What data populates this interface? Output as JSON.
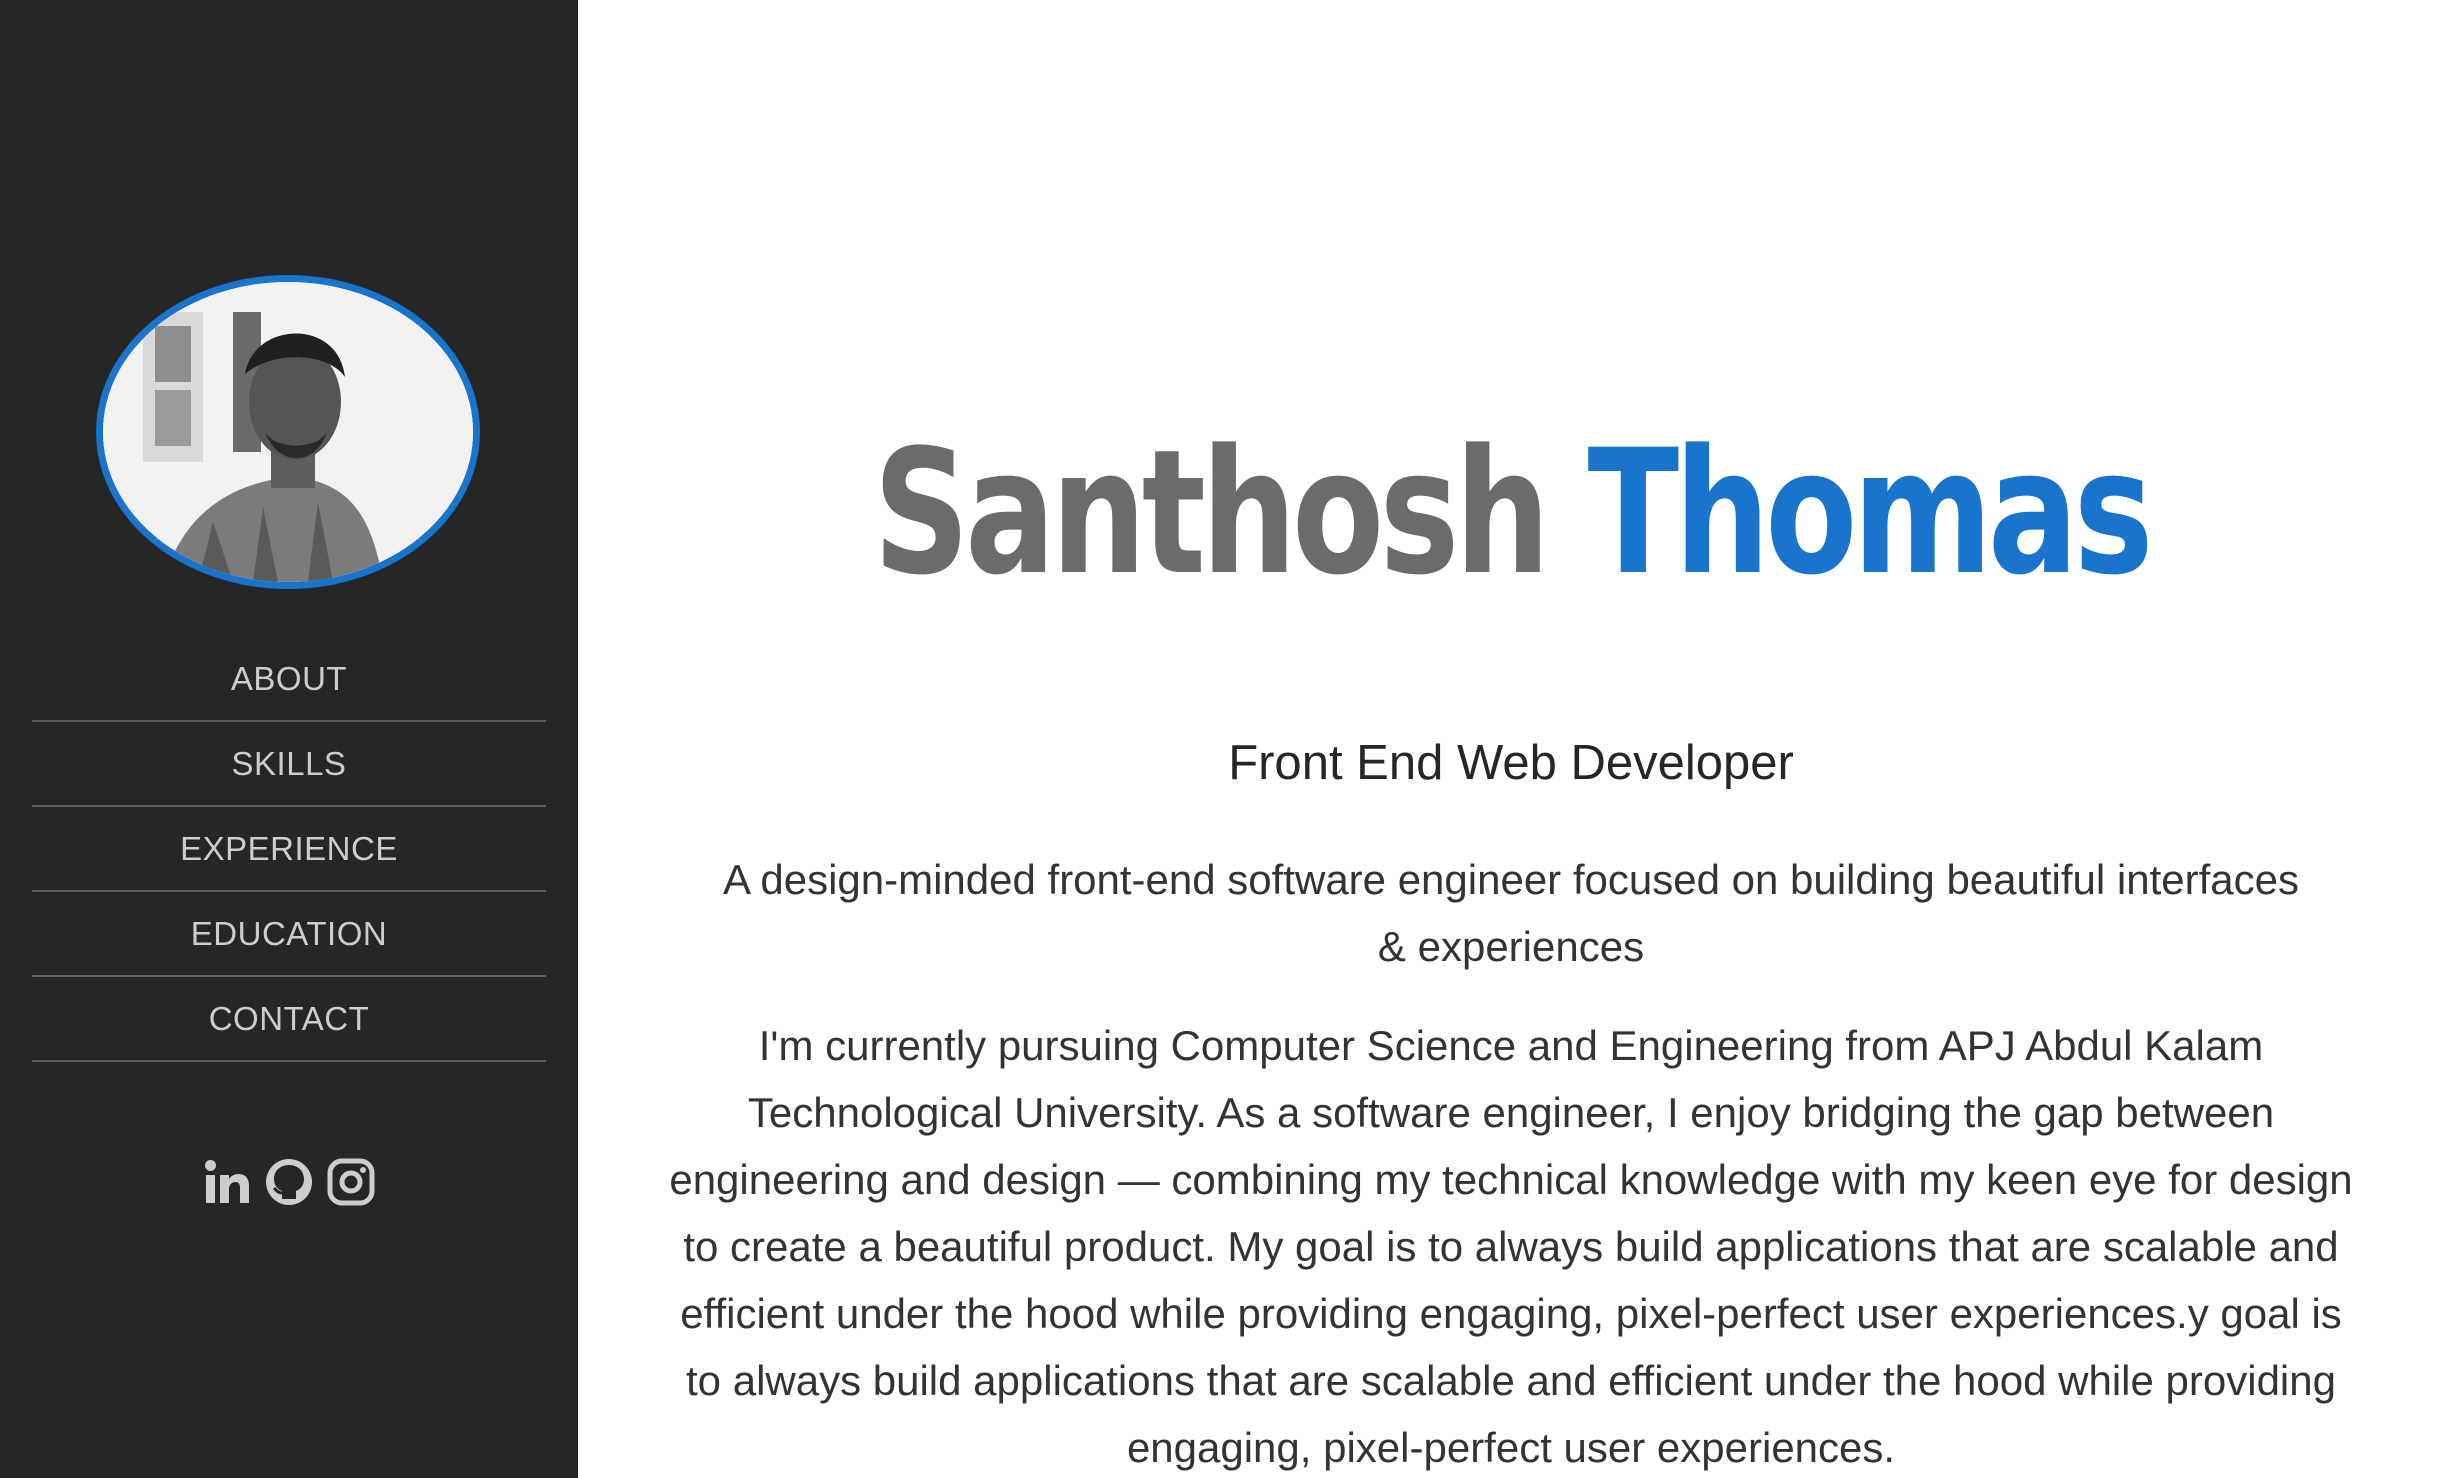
{
  "sidebar": {
    "nav": [
      "ABOUT",
      "SKILLS",
      "EXPERIENCE",
      "EDUCATION",
      "CONTACT"
    ],
    "socials": [
      "linkedin-icon",
      "github-icon",
      "instagram-icon"
    ]
  },
  "main": {
    "first_name": "Santhosh",
    "last_name": "Thomas",
    "role": "Front End Web Developer",
    "tagline": "A design-minded front-end software engineer focused on building beautiful interfaces & experiences",
    "bio": "I'm currently pursuing Computer Science and Engineering from APJ Abdul Kalam Technological University. As a software engineer, I enjoy bridging the gap between engineering and design — combining my technical knowledge with my keen eye for design to create a beautiful product. My goal is to always build applications that are scalable and efficient under the hood while providing engaging, pixel-perfect user experiences.y goal is to always build applications that are scalable and efficient under the hood while providing engaging, pixel-perfect user experiences."
  },
  "colors": {
    "sidebar_bg": "#262626",
    "accent": "#1874cd",
    "name_gray": "#6b6b6b"
  }
}
